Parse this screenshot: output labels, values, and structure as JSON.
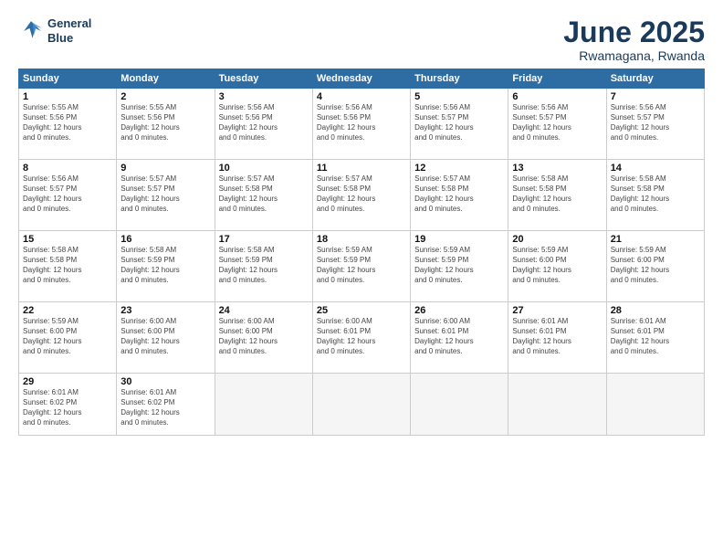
{
  "header": {
    "logo_line1": "General",
    "logo_line2": "Blue",
    "month": "June 2025",
    "location": "Rwamagana, Rwanda"
  },
  "days_of_week": [
    "Sunday",
    "Monday",
    "Tuesday",
    "Wednesday",
    "Thursday",
    "Friday",
    "Saturday"
  ],
  "weeks": [
    [
      {
        "day": "1",
        "info": "Sunrise: 5:55 AM\nSunset: 5:56 PM\nDaylight: 12 hours\nand 0 minutes."
      },
      {
        "day": "2",
        "info": "Sunrise: 5:55 AM\nSunset: 5:56 PM\nDaylight: 12 hours\nand 0 minutes."
      },
      {
        "day": "3",
        "info": "Sunrise: 5:56 AM\nSunset: 5:56 PM\nDaylight: 12 hours\nand 0 minutes."
      },
      {
        "day": "4",
        "info": "Sunrise: 5:56 AM\nSunset: 5:56 PM\nDaylight: 12 hours\nand 0 minutes."
      },
      {
        "day": "5",
        "info": "Sunrise: 5:56 AM\nSunset: 5:57 PM\nDaylight: 12 hours\nand 0 minutes."
      },
      {
        "day": "6",
        "info": "Sunrise: 5:56 AM\nSunset: 5:57 PM\nDaylight: 12 hours\nand 0 minutes."
      },
      {
        "day": "7",
        "info": "Sunrise: 5:56 AM\nSunset: 5:57 PM\nDaylight: 12 hours\nand 0 minutes."
      }
    ],
    [
      {
        "day": "8",
        "info": "Sunrise: 5:56 AM\nSunset: 5:57 PM\nDaylight: 12 hours\nand 0 minutes."
      },
      {
        "day": "9",
        "info": "Sunrise: 5:57 AM\nSunset: 5:57 PM\nDaylight: 12 hours\nand 0 minutes."
      },
      {
        "day": "10",
        "info": "Sunrise: 5:57 AM\nSunset: 5:58 PM\nDaylight: 12 hours\nand 0 minutes."
      },
      {
        "day": "11",
        "info": "Sunrise: 5:57 AM\nSunset: 5:58 PM\nDaylight: 12 hours\nand 0 minutes."
      },
      {
        "day": "12",
        "info": "Sunrise: 5:57 AM\nSunset: 5:58 PM\nDaylight: 12 hours\nand 0 minutes."
      },
      {
        "day": "13",
        "info": "Sunrise: 5:58 AM\nSunset: 5:58 PM\nDaylight: 12 hours\nand 0 minutes."
      },
      {
        "day": "14",
        "info": "Sunrise: 5:58 AM\nSunset: 5:58 PM\nDaylight: 12 hours\nand 0 minutes."
      }
    ],
    [
      {
        "day": "15",
        "info": "Sunrise: 5:58 AM\nSunset: 5:58 PM\nDaylight: 12 hours\nand 0 minutes."
      },
      {
        "day": "16",
        "info": "Sunrise: 5:58 AM\nSunset: 5:59 PM\nDaylight: 12 hours\nand 0 minutes."
      },
      {
        "day": "17",
        "info": "Sunrise: 5:58 AM\nSunset: 5:59 PM\nDaylight: 12 hours\nand 0 minutes."
      },
      {
        "day": "18",
        "info": "Sunrise: 5:59 AM\nSunset: 5:59 PM\nDaylight: 12 hours\nand 0 minutes."
      },
      {
        "day": "19",
        "info": "Sunrise: 5:59 AM\nSunset: 5:59 PM\nDaylight: 12 hours\nand 0 minutes."
      },
      {
        "day": "20",
        "info": "Sunrise: 5:59 AM\nSunset: 6:00 PM\nDaylight: 12 hours\nand 0 minutes."
      },
      {
        "day": "21",
        "info": "Sunrise: 5:59 AM\nSunset: 6:00 PM\nDaylight: 12 hours\nand 0 minutes."
      }
    ],
    [
      {
        "day": "22",
        "info": "Sunrise: 5:59 AM\nSunset: 6:00 PM\nDaylight: 12 hours\nand 0 minutes."
      },
      {
        "day": "23",
        "info": "Sunrise: 6:00 AM\nSunset: 6:00 PM\nDaylight: 12 hours\nand 0 minutes."
      },
      {
        "day": "24",
        "info": "Sunrise: 6:00 AM\nSunset: 6:00 PM\nDaylight: 12 hours\nand 0 minutes."
      },
      {
        "day": "25",
        "info": "Sunrise: 6:00 AM\nSunset: 6:01 PM\nDaylight: 12 hours\nand 0 minutes."
      },
      {
        "day": "26",
        "info": "Sunrise: 6:00 AM\nSunset: 6:01 PM\nDaylight: 12 hours\nand 0 minutes."
      },
      {
        "day": "27",
        "info": "Sunrise: 6:01 AM\nSunset: 6:01 PM\nDaylight: 12 hours\nand 0 minutes."
      },
      {
        "day": "28",
        "info": "Sunrise: 6:01 AM\nSunset: 6:01 PM\nDaylight: 12 hours\nand 0 minutes."
      }
    ],
    [
      {
        "day": "29",
        "info": "Sunrise: 6:01 AM\nSunset: 6:02 PM\nDaylight: 12 hours\nand 0 minutes."
      },
      {
        "day": "30",
        "info": "Sunrise: 6:01 AM\nSunset: 6:02 PM\nDaylight: 12 hours\nand 0 minutes."
      },
      {
        "day": "",
        "info": ""
      },
      {
        "day": "",
        "info": ""
      },
      {
        "day": "",
        "info": ""
      },
      {
        "day": "",
        "info": ""
      },
      {
        "day": "",
        "info": ""
      }
    ]
  ]
}
